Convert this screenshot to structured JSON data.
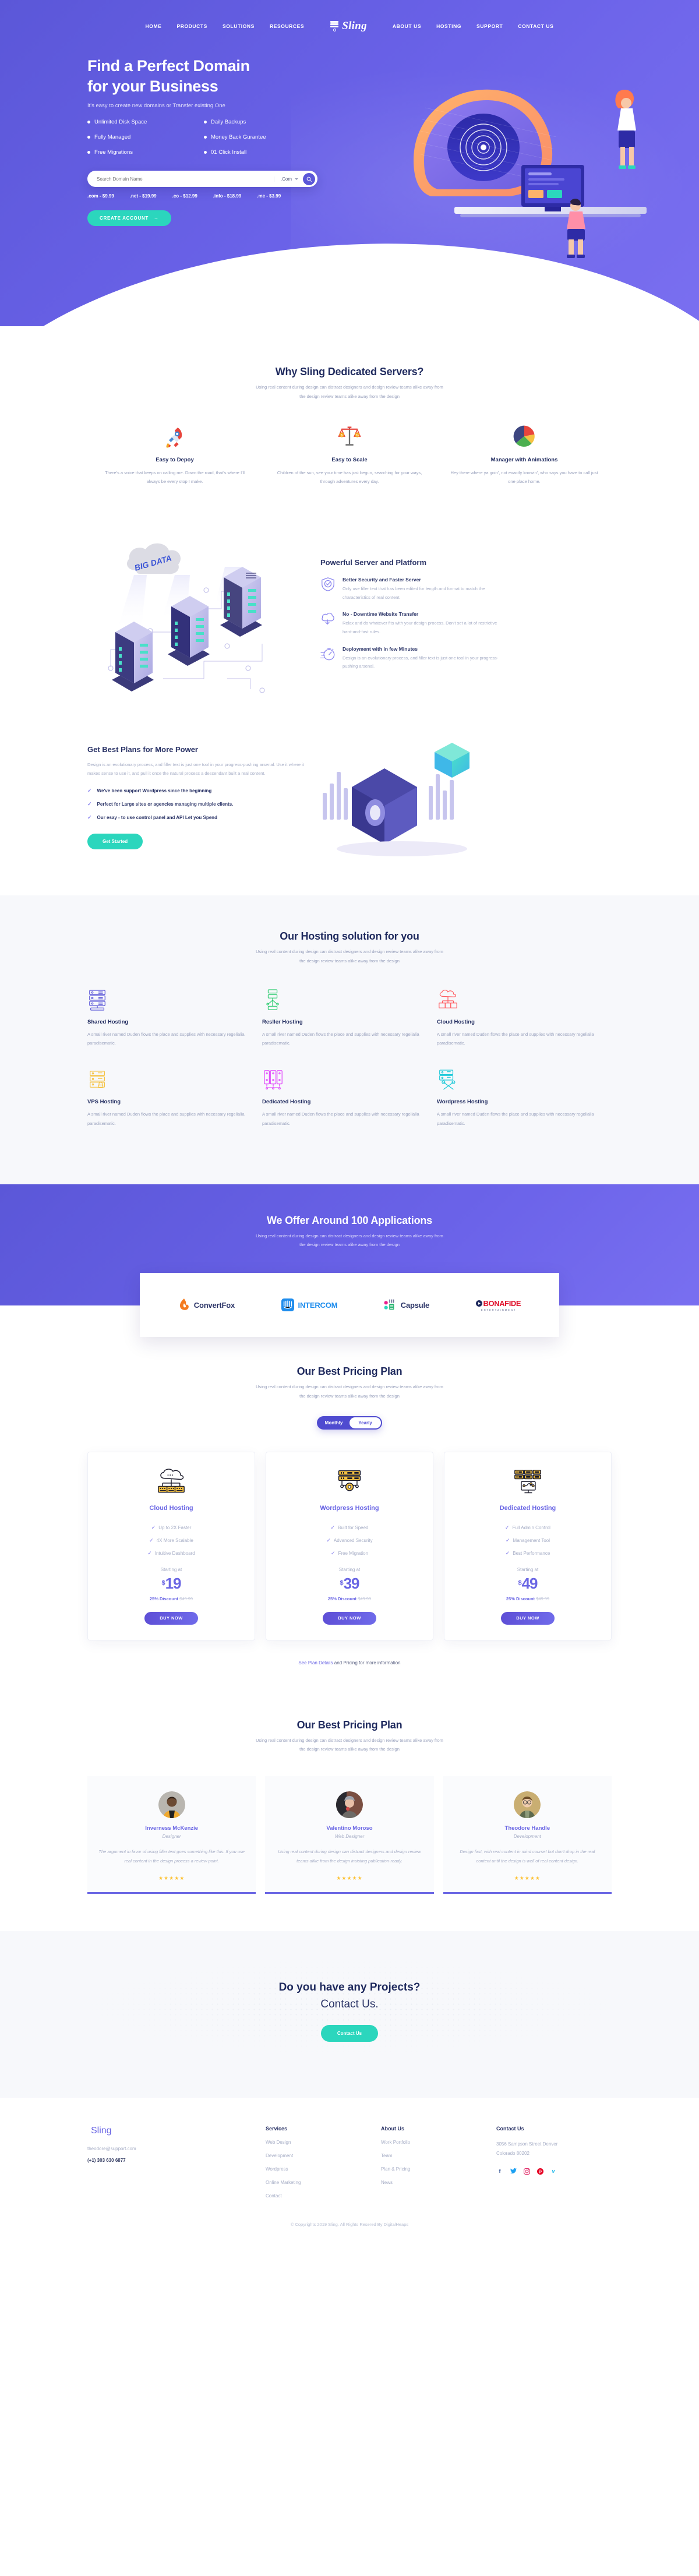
{
  "brand": {
    "name": "Sling"
  },
  "nav": {
    "left": [
      {
        "label": "HOME"
      },
      {
        "label": "PRODUCTS"
      },
      {
        "label": "SOLUTIONS"
      },
      {
        "label": "RESOURCES"
      }
    ],
    "right": [
      {
        "label": "ABOUT US"
      },
      {
        "label": "HOSTING"
      },
      {
        "label": "SUPPORT"
      },
      {
        "label": "CONTACT US"
      }
    ]
  },
  "hero": {
    "title_line1": "Find a Perfect Domain",
    "title_line2": "for your Business",
    "subtitle": "It's easy to create new domains or Transfer existing One",
    "features": [
      "Unlimited Disk Space",
      "Daily Backups",
      "Fully Managed",
      "Money Back Gurantee",
      "Free Migrations",
      "01 Click Install"
    ],
    "search_placeholder": "Search Domain Name",
    "search_value": "",
    "tld_selected": ".Com",
    "prices": [
      ".com - $9.99",
      ".net - $19.99",
      ".co - $12.99",
      ".info - $18.99",
      ".me - $3.99"
    ],
    "cta_label": "CREATE ACCOUNT"
  },
  "why": {
    "title": "Why Sling Dedicated Servers?",
    "desc_line1": "Using real content during design can distract designers and design review teams alike away from",
    "desc_line2": "the design review teams alike away from the design",
    "cards": [
      {
        "icon": "rocket-icon",
        "title": "Easy to Depoy",
        "text": "There's a voice that keeps on calling me. Down the road, that's where I'll always be every stop I make."
      },
      {
        "icon": "scale-icon",
        "title": "Easy to Scale",
        "text": "Children of the sun, see your time has just begun, searching for your ways, through adventures every day."
      },
      {
        "icon": "pie-chart-icon",
        "title": "Manager with Animations",
        "text": "Hey there where ya goin', not exactly knowin', who says you have to call just one place home."
      }
    ]
  },
  "platform": {
    "illustration_label": "BIG DATA",
    "title": "Powerful Server and Platform",
    "items": [
      {
        "icon": "shield-check-icon",
        "title": "Better Security and Faster Server",
        "text": "Only use filler text that has been edited for length and format to match the characteristics of real content."
      },
      {
        "icon": "cloud-download-icon",
        "title": "No - Downtime Website Transfer",
        "text": "Relax and do whatever fits with your design process. Don't set a lot of restrictive hard-and-fast rules."
      },
      {
        "icon": "stopwatch-icon",
        "title": "Deployment with in few Minutes",
        "text": "Design is an evolutionary process, and filler text is just one tool in your progress-pushing arsenal."
      }
    ]
  },
  "plans": {
    "title": "Get Best Plans for More Power",
    "desc": "Design is an evolutionary process, and filler text is just one tool in your progress-pushing arsenal. Use it where it makes sense to use it, and pull it once the natural process a descendant built a real content.",
    "bullets": [
      "We've been support Wordpress since the beginning",
      "Perfect for Large sites or agencies managing multiple clients.",
      "Our esay - to use control panel and API Let you Spend"
    ],
    "cta_label": "Get Started"
  },
  "hosting": {
    "title": "Our Hosting solution for you",
    "desc_line1": "Using real content during design can distract designers and design review teams alike away from",
    "desc_line2": "the design review teams alike away from the design",
    "body_text": "A small river named Duden flows the place and supplies with  necessary regelialia paradisematic.",
    "cards": [
      {
        "icon": "server-rack-icon",
        "title": "Shared Hosting",
        "color": "#5b57d8"
      },
      {
        "icon": "reseller-network-icon",
        "title": "Resller Hosting",
        "color": "#2ecc71"
      },
      {
        "icon": "cloud-servers-icon",
        "title": "Cloud Hosting",
        "color": "#ff5a5f"
      },
      {
        "icon": "vps-lock-icon",
        "title": "VPS Hosting",
        "color": "#f5c242"
      },
      {
        "icon": "dedicated-servers-icon",
        "title": "Dedicated Hosting",
        "color": "#e040fb"
      },
      {
        "icon": "wordpress-tools-icon",
        "title": "Wordpress Hosting",
        "color": "#19c8d8"
      }
    ]
  },
  "apps": {
    "title": "We Offer Around 100 Applications",
    "desc_line1": "Using real content during design can distract designers and design review teams alike away from",
    "desc_line2": "the design review teams alike away from the design",
    "logos": [
      {
        "name": "ConvertFox",
        "icon": "convertfox-icon",
        "color": "#f47b20"
      },
      {
        "name": "INTERCOM",
        "icon": "intercom-icon",
        "color": "#1f8ded"
      },
      {
        "name": "Capsule",
        "icon": "capsule-icon",
        "color": "#2b3467"
      },
      {
        "name": "BONAFIDE",
        "sub": "E N T E R T A I N M E N T",
        "icon": "bonafide-icon",
        "color": "#e0112b"
      }
    ]
  },
  "pricing": {
    "title": "Our Best Pricing Plan",
    "desc_line1": "Using real content during design can distract designers and design review teams alike away from",
    "desc_line2": "the design review teams alike away from the design",
    "toggle": {
      "monthly": "Monthly",
      "yearly": "Yearly",
      "active": "Yearly"
    },
    "cards": [
      {
        "icon": "cloud-hosting-icon",
        "name": "Cloud Hosting",
        "features": [
          "Up to 2X Faster",
          "4X More Scalable",
          "Intuitive Dashboard"
        ],
        "starting_label": "Starting at",
        "currency": "$",
        "price": "19",
        "discount": "25% Discount",
        "old_price": "$49.99",
        "cta": "BUY NOW"
      },
      {
        "icon": "wordpress-hosting-icon",
        "name": "Wordpress Hosting",
        "features": [
          "Built for Speed",
          "Advanced Security",
          "Free Migration"
        ],
        "starting_label": "Starting at",
        "currency": "$",
        "price": "39",
        "discount": "25% Discount",
        "old_price": "$49.99",
        "cta": "BUY NOW"
      },
      {
        "icon": "dedicated-hosting-icon",
        "name": "Dedicated Hosting",
        "features": [
          "Full Admin Control",
          "Management Tool",
          "Best Performance"
        ],
        "starting_label": "Starting at",
        "currency": "$",
        "price": "49",
        "discount": "25% Discount",
        "old_price": "$49.99",
        "cta": "BUY NOW"
      }
    ],
    "note_link": "See Plan Details",
    "note_rest": " and Pricing for more information"
  },
  "testimonials": {
    "title": "Our Best Pricing Plan",
    "desc_line1": "Using real content during design can distract designers and design review teams alike away from",
    "desc_line2": "the design review teams alike away from the design",
    "cards": [
      {
        "name": "Inverness McKenzie",
        "role": "Designer",
        "quote": "The argument in favor of using filler text goes something like this: If you use real content in the design process a review point.",
        "stars": "★★★★★"
      },
      {
        "name": "Valentino Moroso",
        "role": "Web Designer",
        "quote": "Using real content during design can distract designers and design review teams alike from the design insisting publication-ready.",
        "stars": "★★★★★"
      },
      {
        "name": "Theodore Handle",
        "role": "Development",
        "quote": "Design first, with real content in mind course! but don't drop in the real content until the design is well of real content design.",
        "stars": "★★★★★"
      }
    ]
  },
  "cta": {
    "heading": "Do you have any Projects?",
    "subheading": "Contact Us.",
    "button": "Contact Us"
  },
  "footer": {
    "email": "theodore@support.com",
    "phone": "(+1) 303 630 6877",
    "columns": [
      {
        "heading": "Services",
        "links": [
          "Web Design",
          "Development",
          "Wordpress",
          "Online Marketing",
          "Contact"
        ]
      },
      {
        "heading": "About Us",
        "links": [
          "Work Portfolio",
          "Team",
          "Plan & Pricing",
          "News"
        ]
      }
    ],
    "contact": {
      "heading": "Contact Us",
      "address": "3056 Sampson Street Denver Colorado 80202",
      "socials": [
        {
          "name": "facebook-icon",
          "glyph": "f",
          "color": "#3b5998"
        },
        {
          "name": "twitter-icon",
          "glyph": "✉",
          "color": "#1da1f2"
        },
        {
          "name": "instagram-icon",
          "glyph": "◉",
          "color": "#e1306c"
        },
        {
          "name": "pinterest-icon",
          "glyph": "ⓟ",
          "color": "#e60023"
        },
        {
          "name": "vimeo-icon",
          "glyph": "V",
          "color": "#1ab7ea"
        }
      ]
    },
    "copyright": "© Copyrights 2019 Sling. All Rights Resered By DigitalHeaps"
  }
}
